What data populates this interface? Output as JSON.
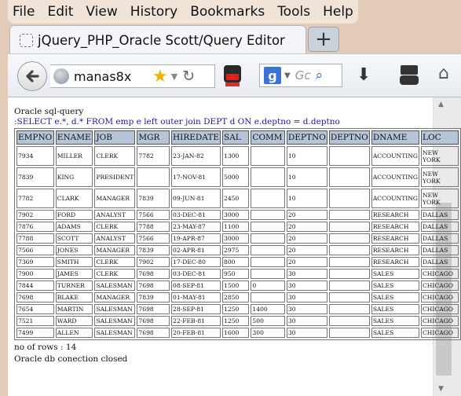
{
  "menu": [
    "File",
    "Edit",
    "View",
    "History",
    "Bookmarks",
    "Tools",
    "Help"
  ],
  "tab": {
    "title": "jQuery_PHP_Oracle Scott/Query Editor",
    "new_tab_label": "+"
  },
  "nav": {
    "url_text": "manas8x",
    "search_placeholder": "Gc"
  },
  "page": {
    "heading": "Oracle sql-query",
    "query": ":SELECT e.*, d.* FROM emp e left outer join DEPT d ON e.deptno = d.deptno",
    "columns": [
      "EMPNO",
      "ENAME",
      "JOB",
      "MGR",
      "HIREDATE",
      "SAL",
      "COMM",
      "DEPTNO",
      "DEPTNO",
      "DNAME",
      "LOC"
    ],
    "rows": [
      [
        "7934",
        "MILLER",
        "CLERK",
        "7782",
        "23-JAN-82",
        "1300",
        "",
        "10",
        "",
        "ACCOUNTING",
        "NEW YORK"
      ],
      [
        "7839",
        "KING",
        "PRESIDENT",
        "",
        "17-NOV-81",
        "5000",
        "",
        "10",
        "",
        "ACCOUNTING",
        "NEW YORK"
      ],
      [
        "7782",
        "CLARK",
        "MANAGER",
        "7839",
        "09-JUN-81",
        "2450",
        "",
        "10",
        "",
        "ACCOUNTING",
        "NEW YORK"
      ],
      [
        "7902",
        "FORD",
        "ANALYST",
        "7566",
        "03-DEC-81",
        "3000",
        "",
        "20",
        "",
        "RESEARCH",
        "DALLAS"
      ],
      [
        "7876",
        "ADAMS",
        "CLERK",
        "7788",
        "23-MAY-87",
        "1100",
        "",
        "20",
        "",
        "RESEARCH",
        "DALLAS"
      ],
      [
        "7788",
        "SCOTT",
        "ANALYST",
        "7566",
        "19-APR-87",
        "3000",
        "",
        "20",
        "",
        "RESEARCH",
        "DALLAS"
      ],
      [
        "7566",
        "JONES",
        "MANAGER",
        "7839",
        "02-APR-81",
        "2975",
        "",
        "20",
        "",
        "RESEARCH",
        "DALLAS"
      ],
      [
        "7369",
        "SMITH",
        "CLERK",
        "7902",
        "17-DEC-80",
        "800",
        "",
        "20",
        "",
        "RESEARCH",
        "DALLAS"
      ],
      [
        "7900",
        "JAMES",
        "CLERK",
        "7698",
        "03-DEC-81",
        "950",
        "",
        "30",
        "",
        "SALES",
        "CHICAGO"
      ],
      [
        "7844",
        "TURNER",
        "SALESMAN",
        "7698",
        "08-SEP-81",
        "1500",
        "0",
        "30",
        "",
        "SALES",
        "CHICAGO"
      ],
      [
        "7698",
        "BLAKE",
        "MANAGER",
        "7839",
        "01-MAY-81",
        "2850",
        "",
        "30",
        "",
        "SALES",
        "CHICAGO"
      ],
      [
        "7654",
        "MARTIN",
        "SALESMAN",
        "7698",
        "28-SEP-81",
        "1250",
        "1400",
        "30",
        "",
        "SALES",
        "CHICAGO"
      ],
      [
        "7521",
        "WARD",
        "SALESMAN",
        "7698",
        "22-FEB-81",
        "1250",
        "500",
        "30",
        "",
        "SALES",
        "CHICAGO"
      ],
      [
        "7499",
        "ALLEN",
        "SALESMAN",
        "7698",
        "20-FEB-81",
        "1600",
        "300",
        "30",
        "",
        "SALES",
        "CHICAGO"
      ]
    ],
    "row_count_text": "no of rows : 14",
    "status_text": "Oracle db conection closed"
  },
  "colors": {
    "header_bg": "#b6c4d8",
    "query_color": "#1a1aa8",
    "chrome_bg": "#e2cbb8"
  }
}
